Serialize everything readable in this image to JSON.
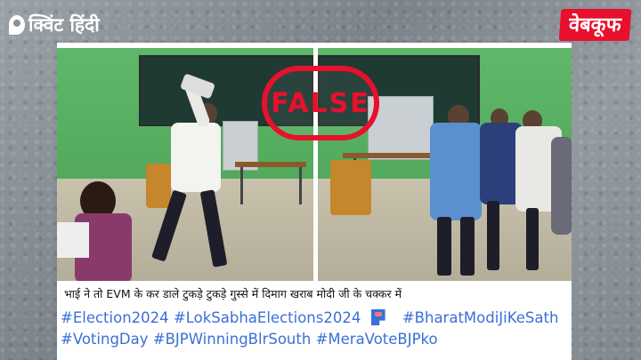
{
  "brand_left": {
    "name": "क्विंट हिंदी"
  },
  "brand_right": {
    "name": "वेबकूफ"
  },
  "stamp": {
    "label": "FALSE"
  },
  "post": {
    "caption": "भाई ने तो EVM के कर डाले टुकड़े टुकड़े गुस्से में दिमाग खराब मोदी जी के चक्कर में",
    "hashtags_line1": [
      "#Election2024",
      "#LokSabhaElections2024"
    ],
    "hashtag_after_flag": "#BharatModiJiKeSath",
    "hashtags_line2": [
      "#VotingDay",
      "#BJPWinningBlrSouth",
      "#MeraVoteBJPko"
    ]
  },
  "colors": {
    "accent_red": "#e8102c",
    "hashtag_blue": "#3a6fd8"
  },
  "icons": {
    "flag": "flag-icon",
    "logo_mark": "quint-logo-icon"
  }
}
